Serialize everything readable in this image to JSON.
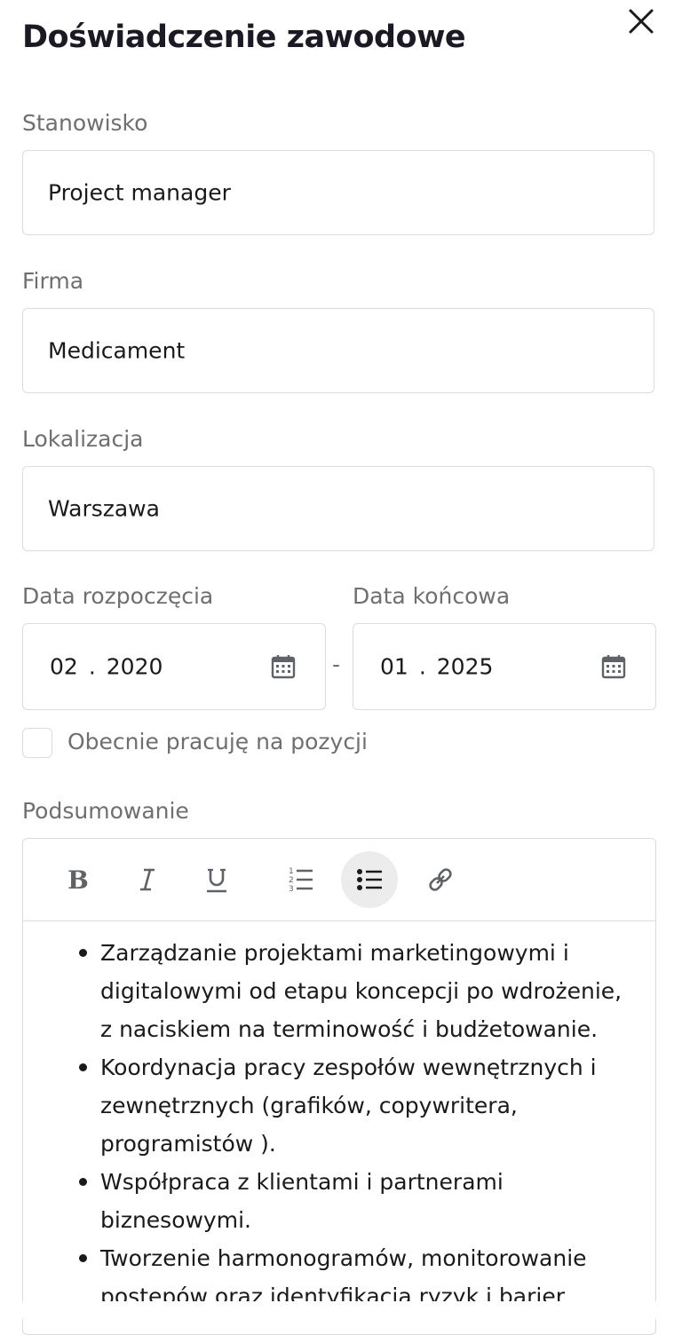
{
  "header": {
    "title": "Doświadczenie zawodowe",
    "close_icon": "close-icon"
  },
  "form": {
    "position": {
      "label": "Stanowisko",
      "value": "Project manager"
    },
    "company": {
      "label": "Firma",
      "value": "Medicament"
    },
    "location": {
      "label": "Lokalizacja",
      "value": "Warszawa"
    },
    "start_date": {
      "label": "Data rozpoczęcia",
      "month": "02",
      "separator": ".",
      "year": "2020",
      "icon": "calendar-icon"
    },
    "end_date": {
      "label": "Data końcowa",
      "month": "01",
      "separator": ".",
      "year": "2025",
      "icon": "calendar-icon"
    },
    "range_separator": "-",
    "current_position": {
      "label": "Obecnie pracuję na pozycji",
      "checked": false
    }
  },
  "summary": {
    "label": "Podsumowanie",
    "toolbar": [
      {
        "name": "bold",
        "icon": "bold-icon",
        "active": false
      },
      {
        "name": "italic",
        "icon": "italic-icon",
        "active": false
      },
      {
        "name": "underline",
        "icon": "underline-icon",
        "active": false
      },
      {
        "name": "ordered-list",
        "icon": "ordered-list-icon",
        "active": false
      },
      {
        "name": "bullet-list",
        "icon": "bullet-list-icon",
        "active": true
      },
      {
        "name": "link",
        "icon": "link-icon",
        "active": false
      }
    ],
    "items": [
      "Zarządzanie projektami marketingowymi i digitalowymi od etapu koncepcji po wdrożenie, z naciskiem na terminowość i budżetowanie.",
      "Koordynacja pracy zespołów wewnętrznych i zewnętrznych (grafików, copywritera, programistów ).",
      "Współpraca z klientami i partnerami biznesowymi.",
      "Tworzenie harmonogramów, monitorowanie postępów oraz identyfikacja ryzyk i barier"
    ]
  },
  "colors": {
    "title": "#1b1a24",
    "label": "#6f6f6f",
    "border": "#dcdcdc",
    "active_tool_bg": "#ececec"
  }
}
